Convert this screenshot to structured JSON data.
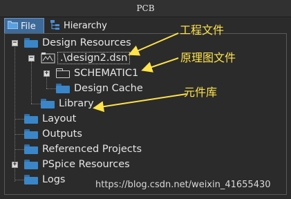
{
  "window": {
    "title": "PCB"
  },
  "tabs": [
    {
      "label": "File",
      "active": true,
      "icon": "folder-tab-icon"
    },
    {
      "label": "Hierarchy",
      "active": false,
      "icon": "hierarchy-icon"
    }
  ],
  "tree": {
    "design_resources": "Design Resources",
    "design_file": ".\\design2.dsn",
    "schematic": "SCHEMATIC1",
    "design_cache": "Design Cache",
    "library": "Library",
    "layout": "Layout",
    "outputs": "Outputs",
    "referenced_projects": "Referenced Projects",
    "pspice_resources": "PSpice Resources",
    "logs": "Logs"
  },
  "annotations": {
    "project_file": "工程文件",
    "schematic_file": "原理图文件",
    "component_library": "元件库",
    "color": "#ffe34a"
  },
  "watermark": "https://blog.csdn.net/weixin_41655430"
}
